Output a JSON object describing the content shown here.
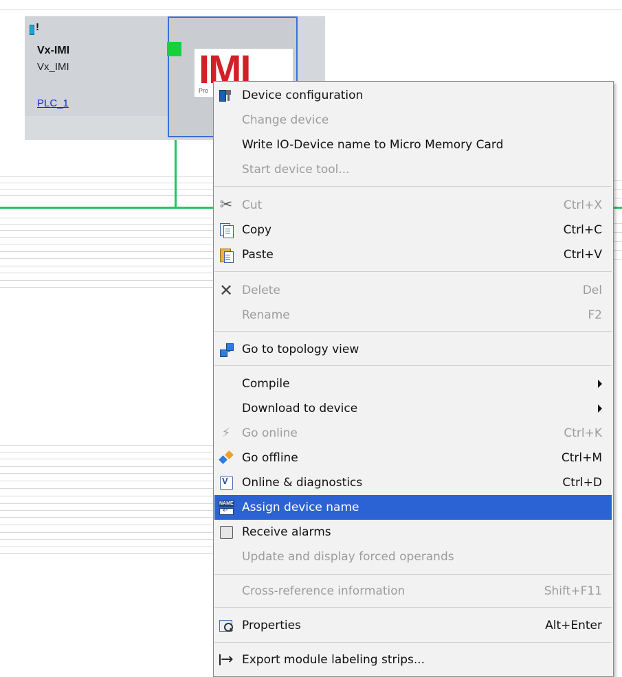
{
  "device": {
    "name": "Vx-IMI",
    "type": "Vx_IMI",
    "link": "PLC_1",
    "logo_text": "IMI",
    "logo_subtext": "Pro"
  },
  "colors": {
    "bus": "#22c55e",
    "highlight": "#2b63d4",
    "link": "#0a2bd1",
    "logo": "#d51f26"
  },
  "menu": {
    "items": [
      {
        "label": "Device configuration",
        "shortcut": "",
        "enabled": true,
        "icon": "device-configuration-icon"
      },
      {
        "label": "Change device",
        "shortcut": "",
        "enabled": false,
        "icon": ""
      },
      {
        "label": "Write IO-Device name to Micro Memory Card",
        "shortcut": "",
        "enabled": true,
        "icon": ""
      },
      {
        "label": "Start device tool...",
        "shortcut": "",
        "enabled": false,
        "icon": ""
      },
      {
        "label": "Cut",
        "shortcut": "Ctrl+X",
        "enabled": false,
        "icon": "scissors-icon"
      },
      {
        "label": "Copy",
        "shortcut": "Ctrl+C",
        "enabled": true,
        "icon": "copy-icon"
      },
      {
        "label": "Paste",
        "shortcut": "Ctrl+V",
        "enabled": true,
        "icon": "paste-icon"
      },
      {
        "label": "Delete",
        "shortcut": "Del",
        "enabled": false,
        "icon": "delete-x-icon"
      },
      {
        "label": "Rename",
        "shortcut": "F2",
        "enabled": false,
        "icon": ""
      },
      {
        "label": "Go to topology view",
        "shortcut": "",
        "enabled": true,
        "icon": "topology-icon"
      },
      {
        "label": "Compile",
        "shortcut": "",
        "enabled": true,
        "submenu": true,
        "icon": ""
      },
      {
        "label": "Download to device",
        "shortcut": "",
        "enabled": true,
        "submenu": true,
        "icon": ""
      },
      {
        "label": "Go online",
        "shortcut": "Ctrl+K",
        "enabled": false,
        "icon": "go-online-icon"
      },
      {
        "label": "Go offline",
        "shortcut": "Ctrl+M",
        "enabled": true,
        "icon": "go-offline-icon"
      },
      {
        "label": "Online & diagnostics",
        "shortcut": "Ctrl+D",
        "enabled": true,
        "icon": "diagnostics-icon"
      },
      {
        "label": "Assign device name",
        "shortcut": "",
        "enabled": true,
        "highlighted": true,
        "icon": "assign-name-icon"
      },
      {
        "label": "Receive alarms",
        "shortcut": "",
        "enabled": true,
        "icon": "alarm-checkbox-icon"
      },
      {
        "label": "Update and display forced operands",
        "shortcut": "",
        "enabled": false,
        "icon": ""
      },
      {
        "label": "Cross-reference information",
        "shortcut": "Shift+F11",
        "enabled": false,
        "icon": ""
      },
      {
        "label": "Properties",
        "shortcut": "Alt+Enter",
        "enabled": true,
        "icon": "properties-icon"
      },
      {
        "label": "Export module labeling strips...",
        "shortcut": "",
        "enabled": true,
        "icon": "export-arrow-icon"
      }
    ]
  }
}
